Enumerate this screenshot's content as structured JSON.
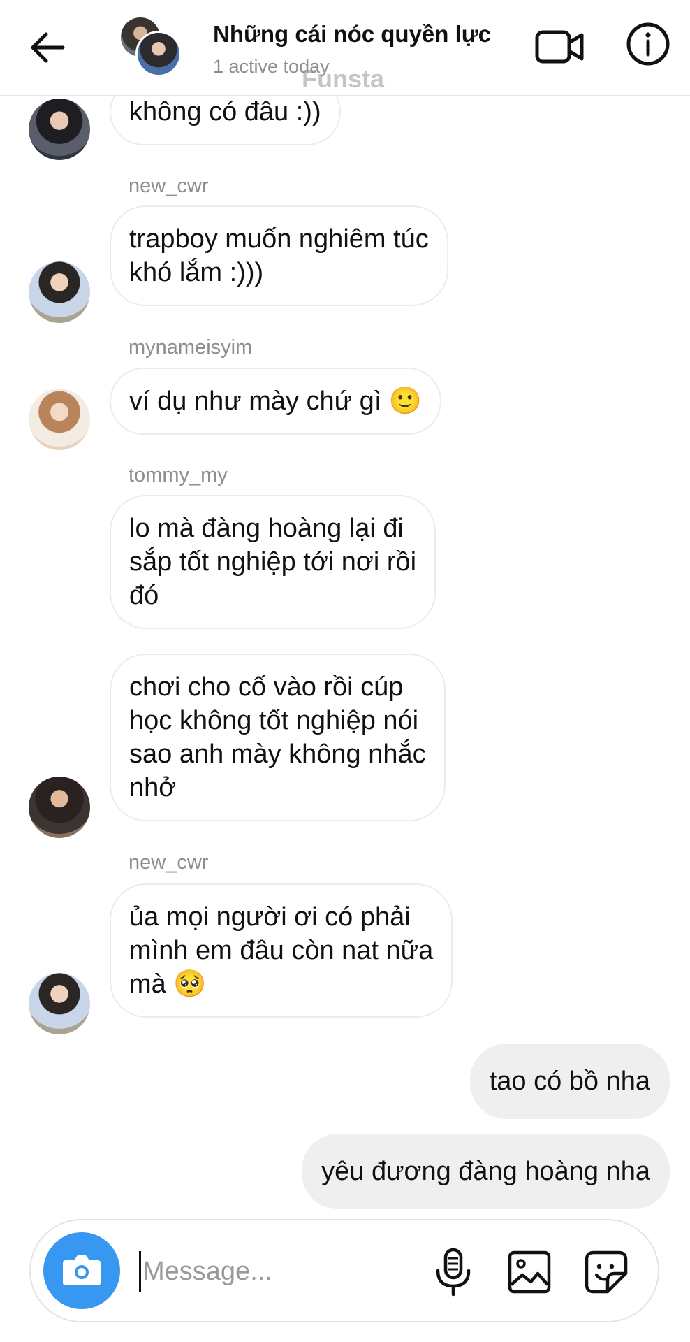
{
  "header": {
    "title": "Những cái nóc quyền lực",
    "subtitle": "1 active today",
    "watermark": "Funsta"
  },
  "messages": {
    "m0": {
      "text": "không có đâu :))"
    },
    "m1": {
      "sender": "new_cwr",
      "lines": [
        "trapboy muốn nghiêm túc",
        "khó lắm :)))"
      ]
    },
    "m2": {
      "sender": "mynameisyim",
      "text": "ví dụ như mày chứ gì 🙂"
    },
    "m3": {
      "sender": "tommy_my",
      "lines": [
        "lo mà đàng hoàng lại đi",
        "sắp tốt nghiệp tới nơi rồi",
        "đó"
      ]
    },
    "m4": {
      "lines": [
        "chơi cho cố vào rồi cúp",
        "học không tốt nghiệp nói",
        "sao anh mày không nhắc",
        "nhở"
      ]
    },
    "m5": {
      "sender": "new_cwr",
      "lines": [
        "ủa mọi người ơi có phải",
        "mình em đâu còn nat nữa",
        "mà 🥺"
      ]
    },
    "out1": {
      "text": "tao có bồ nha"
    },
    "out2": {
      "text": "yêu đương đàng hoàng nha"
    }
  },
  "composer": {
    "placeholder": "Message..."
  },
  "icons": {
    "back": "arrow-left-icon",
    "video": "video-camera-icon",
    "info": "info-icon",
    "camera": "camera-icon",
    "mic": "microphone-icon",
    "gallery": "image-icon",
    "sticker": "sticker-icon"
  },
  "colors": {
    "accent": "#3897f0",
    "outgoing_bubble": "#efefef",
    "muted_text": "#8e8e8e"
  }
}
